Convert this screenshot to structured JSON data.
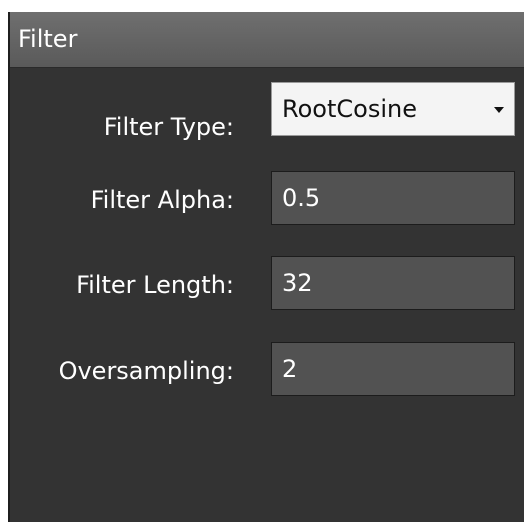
{
  "panel": {
    "title": "Filter"
  },
  "fields": {
    "filter_type": {
      "label": "Filter Type:",
      "value": "RootCosine"
    },
    "filter_alpha": {
      "label": "Filter Alpha:",
      "value": "0.5"
    },
    "filter_length": {
      "label": "Filter Length:",
      "value": "32"
    },
    "oversampling": {
      "label": "Oversampling:",
      "value": "2"
    }
  }
}
